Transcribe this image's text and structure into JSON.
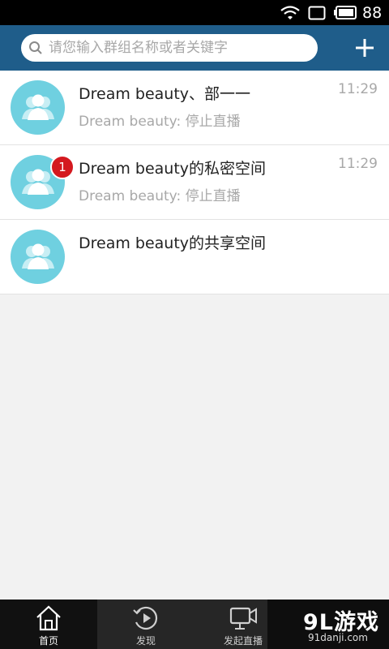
{
  "status_bar": {
    "battery_level": "88",
    "icons": [
      "wifi-icon",
      "signal-icon",
      "battery-icon"
    ]
  },
  "header": {
    "search_placeholder": "请您输入群组名称或者关键字",
    "add_icon": "plus-icon",
    "background": "#1f5d8a"
  },
  "groups": [
    {
      "title": "Dream beauty、部一一",
      "subtitle": "Dream beauty: 停止直播",
      "time": "11:29",
      "unread": ""
    },
    {
      "title": "Dream beauty的私密空间",
      "subtitle": "Dream beauty: 停止直播",
      "time": "11:29",
      "unread": "1"
    },
    {
      "title": "Dream beauty的共享空间",
      "subtitle": "",
      "time": "",
      "unread": ""
    }
  ],
  "tabs": [
    {
      "label": "首页",
      "icon": "home-icon",
      "active": true
    },
    {
      "label": "发现",
      "icon": "discover-icon",
      "active": false
    },
    {
      "label": "发起直播",
      "icon": "live-video-icon",
      "active": false
    }
  ],
  "watermark": {
    "logo": "9L游戏",
    "url": "91danji.com"
  },
  "colors": {
    "avatar": "#6fd0e0",
    "badge": "#d4191f",
    "tab_bar": "#262626"
  }
}
